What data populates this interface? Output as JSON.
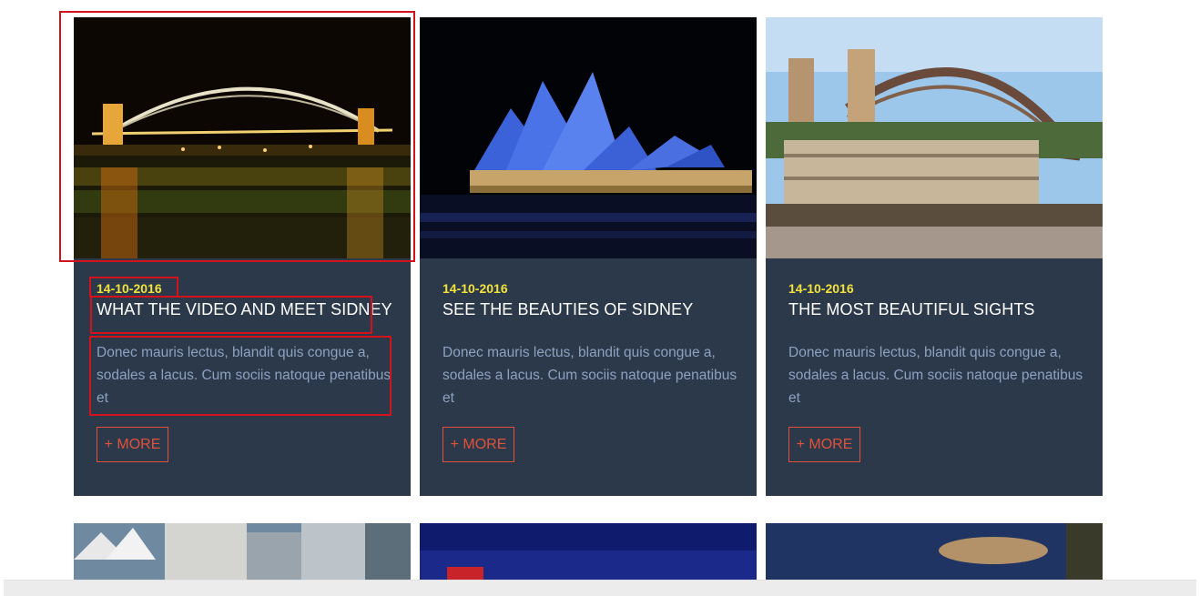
{
  "cards": [
    {
      "image_alt": "Sydney Harbour Bridge at night",
      "date": "14-10-2016",
      "title": "WHAT THE VIDEO AND MEET SIDNEY",
      "description": "Donec mauris lectus, blandit quis congue a, sodales a lacus. Cum sociis natoque penatibus et",
      "more_label": "+ MORE"
    },
    {
      "image_alt": "Sydney Opera House illuminated",
      "date": "14-10-2016",
      "title": "SEE THE BEAUTIES OF SIDNEY",
      "description": "Donec mauris lectus, blandit quis congue a, sodales a lacus. Cum sociis natoque penatibus et",
      "more_label": "+ MORE"
    },
    {
      "image_alt": "Sydney Harbour Bridge by day",
      "date": "14-10-2016",
      "title": "THE MOST BEAUTIFUL SIGHTS",
      "description": "Donec mauris lectus, blandit quis congue a, sodales a lacus. Cum sociis natoque penatibus et",
      "more_label": "+ MORE"
    }
  ],
  "colors": {
    "card_bg": "#2c394a",
    "date": "#f2e23b",
    "title": "#ffffff",
    "description": "#8ea1c1",
    "more_accent": "#e0523a",
    "highlight_box": "#d3121b"
  }
}
